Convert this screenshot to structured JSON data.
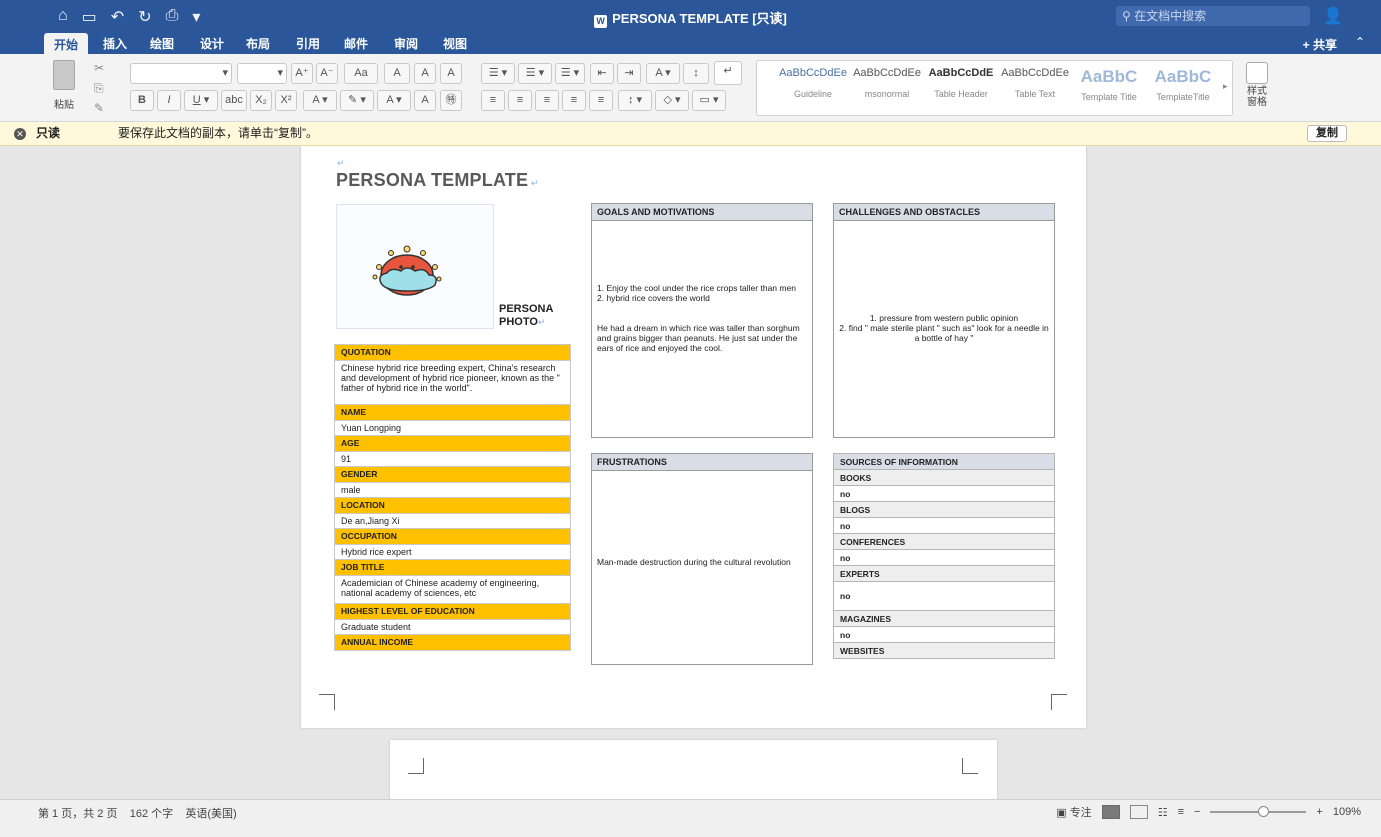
{
  "titlebar": {
    "title": "PERSONA TEMPLATE [只读]",
    "search_placeholder": "在文档中搜索"
  },
  "tabs": [
    "开始",
    "插入",
    "绘图",
    "设计",
    "布局",
    "引用",
    "邮件",
    "审阅",
    "视图"
  ],
  "share_label": "共享",
  "ribbon": {
    "paste_label": "粘贴",
    "style_pane_label": "样式\n窗格",
    "styles": [
      {
        "preview": "AaBbCcDdEe",
        "name": "Guideline"
      },
      {
        "preview": "AaBbCcDdEe",
        "name": "msonormal"
      },
      {
        "preview": "AaBbCcDdE",
        "name": "Table Header"
      },
      {
        "preview": "AaBbCcDdEe",
        "name": "Table Text"
      },
      {
        "preview": "AaBbC",
        "name": "Template Title"
      },
      {
        "preview": "AaBbC",
        "name": "TemplateTitle"
      }
    ]
  },
  "readonly_bar": {
    "label": "只读",
    "message": "要保存此文档的副本，请单击“复制”。",
    "copy_button": "复制"
  },
  "document": {
    "heading": "PERSONA TEMPLATE",
    "photo_label": "PERSONA PHOTO",
    "left_rows": [
      {
        "header": "QUOTATION",
        "value": "Chinese hybrid rice breeding expert, China's research and development of hybrid rice pioneer, known as the \" father of hybrid rice in the world\"."
      },
      {
        "header": "NAME",
        "value": "Yuan Longping"
      },
      {
        "header": "AGE",
        "value": "91"
      },
      {
        "header": "GENDER",
        "value": "male"
      },
      {
        "header": "LOCATION",
        "value": "De an,Jiang Xi"
      },
      {
        "header": "OCCUPATION",
        "value": "Hybrid rice expert"
      },
      {
        "header": "JOB TITLE",
        "value": "Academician of Chinese academy of engineering, national academy of sciences, etc"
      },
      {
        "header": "HIGHEST LEVEL OF EDUCATION",
        "value": "Graduate student"
      },
      {
        "header": "ANNUAL INCOME",
        "value": ""
      }
    ],
    "goals": {
      "header": "GOALS AND MOTIVATIONS",
      "item1": "1.   Enjoy the cool under the rice crops taller than men",
      "item2": "2.   hybrid rice covers the world",
      "paragraph": "He had a dream in which rice was taller than sorghum and grains bigger than peanuts.  He just sat under the ears of rice and enjoyed the cool."
    },
    "challenges": {
      "header": "CHALLENGES AND OBSTACLES",
      "item1": "1. pressure from western public opinion",
      "item2": "2. find \" male sterile plant \"  such as\" look for a needle in a bottle of hay \""
    },
    "frustrations": {
      "header": "FRUSTRATIONS",
      "text": "Man-made destruction during the cultural revolution"
    },
    "sources": {
      "header": "SOURCES OF INFORMATION",
      "rows": [
        {
          "label": "BOOKS",
          "value": "no"
        },
        {
          "label": "BLOGS",
          "value": "no"
        },
        {
          "label": "CONFERENCES",
          "value": "no"
        },
        {
          "label": "EXPERTS",
          "value": "no"
        },
        {
          "label": "MAGAZINES",
          "value": "no"
        },
        {
          "label": "WEBSITES",
          "value": ""
        }
      ]
    }
  },
  "statusbar": {
    "page_info": "第 1 页，共 2 页",
    "word_count": "162 个字",
    "language": "英语(美国)",
    "focus_label": "专注",
    "zoom": "109%",
    "zoom_level_fraction": 0.55
  }
}
